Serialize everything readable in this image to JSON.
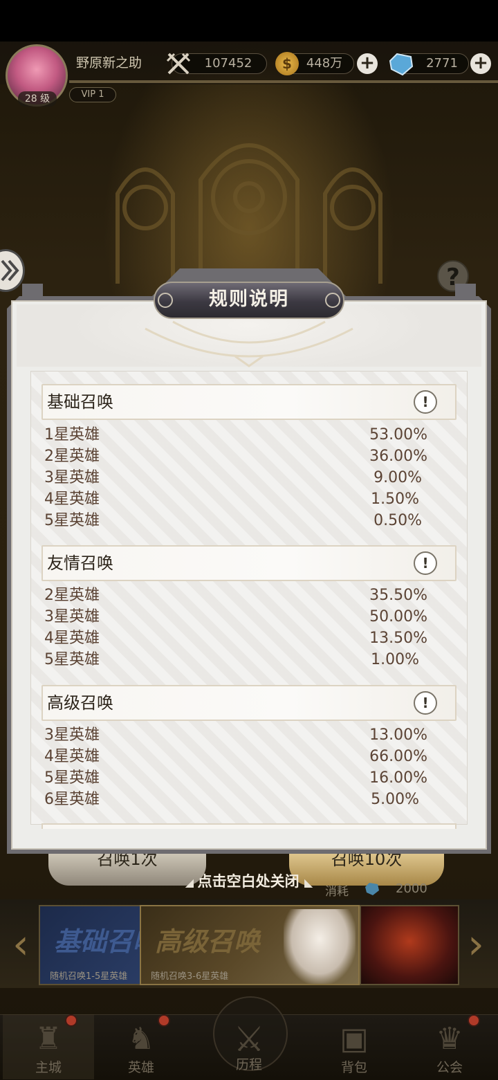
{
  "player": {
    "name": "野原新之助",
    "level": "28 级",
    "vip": "VIP 1",
    "power": "107452",
    "gold": "448万",
    "diamonds": "2771",
    "plus": "+"
  },
  "modal": {
    "title": "规则说明",
    "close_hint": "点击空白处关闭",
    "info_glyph": "!",
    "sections": [
      {
        "title": "基础召唤",
        "rows": [
          {
            "label": "1星英雄",
            "value": "53.00%"
          },
          {
            "label": "2星英雄",
            "value": "36.00%"
          },
          {
            "label": "3星英雄",
            "value": "9.00%"
          },
          {
            "label": "4星英雄",
            "value": "1.50%"
          },
          {
            "label": "5星英雄",
            "value": "0.50%"
          }
        ]
      },
      {
        "title": "友情召唤",
        "rows": [
          {
            "label": "2星英雄",
            "value": "35.50%"
          },
          {
            "label": "3星英雄",
            "value": "50.00%"
          },
          {
            "label": "4星英雄",
            "value": "13.50%"
          },
          {
            "label": "5星英雄",
            "value": "1.00%"
          }
        ]
      },
      {
        "title": "高级召唤",
        "rows": [
          {
            "label": "3星英雄",
            "value": "13.00%"
          },
          {
            "label": "4星英雄",
            "value": "66.00%"
          },
          {
            "label": "5星英雄",
            "value": "16.00%"
          },
          {
            "label": "6星英雄",
            "value": "5.00%"
          }
        ]
      }
    ]
  },
  "summon": {
    "once_label": "召唤1次",
    "ten_label": "召唤10次",
    "cost_label": "消耗",
    "cost_value": "2000"
  },
  "banners": [
    {
      "title": "基础召唤",
      "subtitle": "随机召唤1-5星英雄"
    },
    {
      "title": "高级召唤",
      "subtitle": "随机召唤3-6星英雄"
    }
  ],
  "nav": [
    {
      "label": "主城",
      "icon": "castle-icon",
      "badge": true
    },
    {
      "label": "英雄",
      "icon": "hero-helmet-icon",
      "badge": true
    },
    {
      "label": "历程",
      "icon": "crossed-swords-icon",
      "badge": false
    },
    {
      "label": "背包",
      "icon": "backpack-icon",
      "badge": false
    },
    {
      "label": "公会",
      "icon": "guild-crest-icon",
      "badge": true
    }
  ],
  "icons": {
    "power": "crossed-swords-icon",
    "gold": "coin-icon",
    "diamond": "gem-icon",
    "help": "question-icon",
    "expand": "double-chevron-right-icon",
    "info": "exclamation-icon"
  },
  "colors": {
    "row_text": "#5b4334",
    "panel_bg": "#ecebe8",
    "title_plate": "#3c3942"
  }
}
